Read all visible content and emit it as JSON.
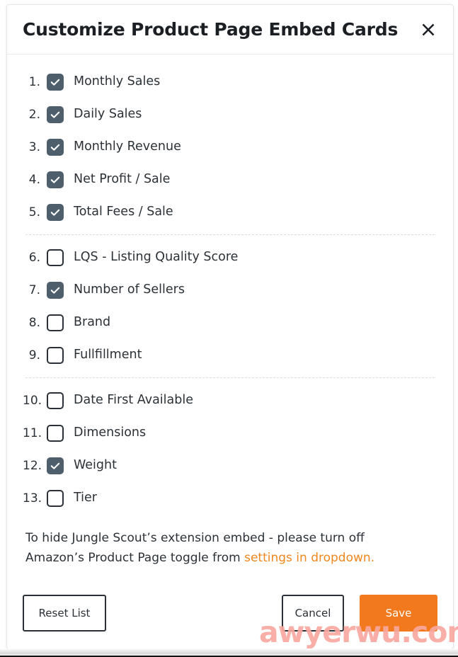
{
  "modal": {
    "title": "Customize Product Page Embed Cards",
    "close_icon": "close-icon"
  },
  "options": [
    {
      "num": "1.",
      "label": "Monthly Sales",
      "checked": true
    },
    {
      "num": "2.",
      "label": "Daily Sales",
      "checked": true
    },
    {
      "num": "3.",
      "label": "Monthly Revenue",
      "checked": true
    },
    {
      "num": "4.",
      "label": "Net Profit / Sale",
      "checked": true
    },
    {
      "num": "5.",
      "label": "Total Fees / Sale",
      "checked": true
    },
    {
      "num": "6.",
      "label": "LQS - Listing Quality Score",
      "checked": false
    },
    {
      "num": "7.",
      "label": "Number of Sellers",
      "checked": true
    },
    {
      "num": "8.",
      "label": "Brand",
      "checked": false
    },
    {
      "num": "9.",
      "label": "Fullfillment",
      "checked": false
    },
    {
      "num": "10.",
      "label": "Date First Available",
      "checked": false
    },
    {
      "num": "11.",
      "label": "Dimensions",
      "checked": false
    },
    {
      "num": "12.",
      "label": "Weight",
      "checked": true
    },
    {
      "num": "13.",
      "label": "Tier",
      "checked": false
    }
  ],
  "group_breaks_after": [
    5,
    9
  ],
  "note": {
    "text_before": "To hide Jungle Scout’s extension embed - please turn off Amazon’s Product Page toggle from ",
    "link_text": "settings in dropdown."
  },
  "footer": {
    "reset_label": "Reset List",
    "cancel_label": "Cancel",
    "save_label": "Save"
  },
  "watermark": {
    "text": "awyerwu.com"
  },
  "colors": {
    "accent_orange": "#f2791e",
    "link_orange": "#f0861d",
    "checkbox_checked": "#4e5f6b",
    "text": "#2b3136",
    "watermark": "#f9a8a0"
  }
}
